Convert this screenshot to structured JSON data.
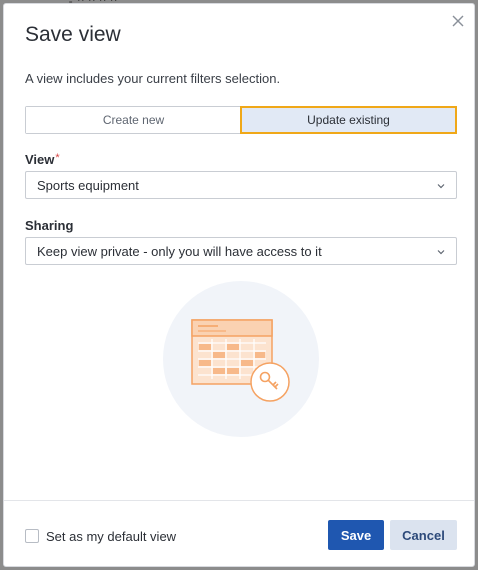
{
  "dialog": {
    "title": "Save view",
    "description": "A view includes your current filters selection.",
    "close_icon": "close-icon"
  },
  "mode_toggle": {
    "options": [
      {
        "label": "Create new",
        "selected": false
      },
      {
        "label": "Update existing",
        "selected": true
      }
    ]
  },
  "view_field": {
    "label": "View",
    "required_marker": "*",
    "value": "Sports equipment"
  },
  "sharing_field": {
    "label": "Sharing",
    "value": "Keep view private - only you will have access to it"
  },
  "footer": {
    "default_checkbox_label": "Set as my default view",
    "default_checked": false,
    "save_label": "Save",
    "cancel_label": "Cancel"
  },
  "colors": {
    "primary": "#1f57b0",
    "secondary_button": "#dbe3ef",
    "selected_toggle": "#e1e9f5",
    "focus_outline": "#f0a818",
    "illustration_accent": "#f5a262"
  }
}
